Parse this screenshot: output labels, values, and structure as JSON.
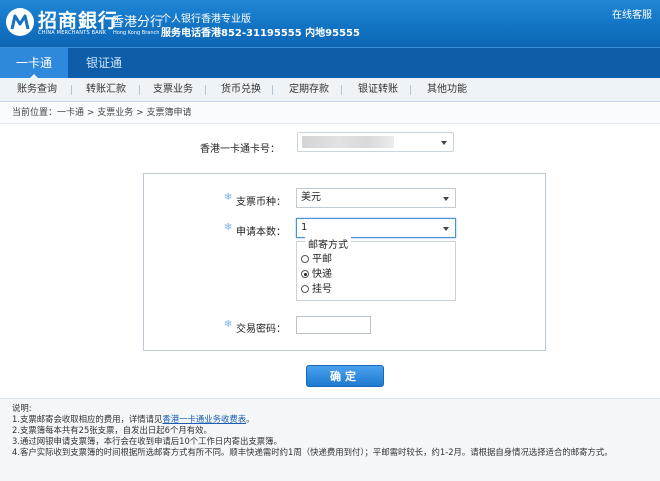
{
  "header": {
    "bank_name_cn": "招商銀行",
    "bank_name_en": "CHINA MERCHANTS BANK",
    "branch_cn": "香港分行",
    "branch_en": "Hong Kong Branch",
    "tagline": "个人银行香港专业版",
    "hotline": "服务电话香港852-31195555 内地95555",
    "online_service": "在线客服"
  },
  "main_nav": {
    "tabs": [
      {
        "label": "一卡通",
        "active": true
      },
      {
        "label": "银证通",
        "active": false
      }
    ]
  },
  "sub_nav": {
    "items": [
      "账务查询",
      "转账汇款",
      "支票业务",
      "货币兑换",
      "定期存款",
      "银证转账",
      "其他功能"
    ]
  },
  "breadcrumb": "当前位置：一卡通 > 支票业务 > 支票簿申请",
  "form": {
    "card_label": "香港一卡通卡号：",
    "currency_label": "支票币种：",
    "currency_value": "美元",
    "quantity_label": "申请本数：",
    "quantity_value": "1",
    "mail_legend": "邮寄方式",
    "mail_options": [
      {
        "label": "平邮",
        "checked": false
      },
      {
        "label": "快递",
        "checked": true
      },
      {
        "label": "挂号",
        "checked": false
      }
    ],
    "password_label": "交易密码：",
    "required_mark": "❄",
    "confirm_label": "确定"
  },
  "notes": {
    "title": "说明:",
    "line1_prefix": "1.支票邮寄会收取相应的费用，详情请见",
    "line1_link": "香港一卡通业务收费表",
    "line1_suffix": "。",
    "line2": "2.支票簿每本共有25张支票，自发出日起6个月有效。",
    "line3": "3.通过网银申请支票簿，本行会在收到申请后10个工作日内寄出支票簿。",
    "line4": "4.客户实际收到支票簿的时间根据所选邮寄方式有所不同。顺丰快递需时约1周（快递费用到付）；平邮需时较长，约1-2月。请根据自身情况选择适合的邮寄方式。"
  },
  "colors": {
    "header_blue": "#1272c2",
    "nav_blue": "#0d5da8",
    "active_tab": "#2e88dc",
    "link": "#1a5fb4"
  }
}
